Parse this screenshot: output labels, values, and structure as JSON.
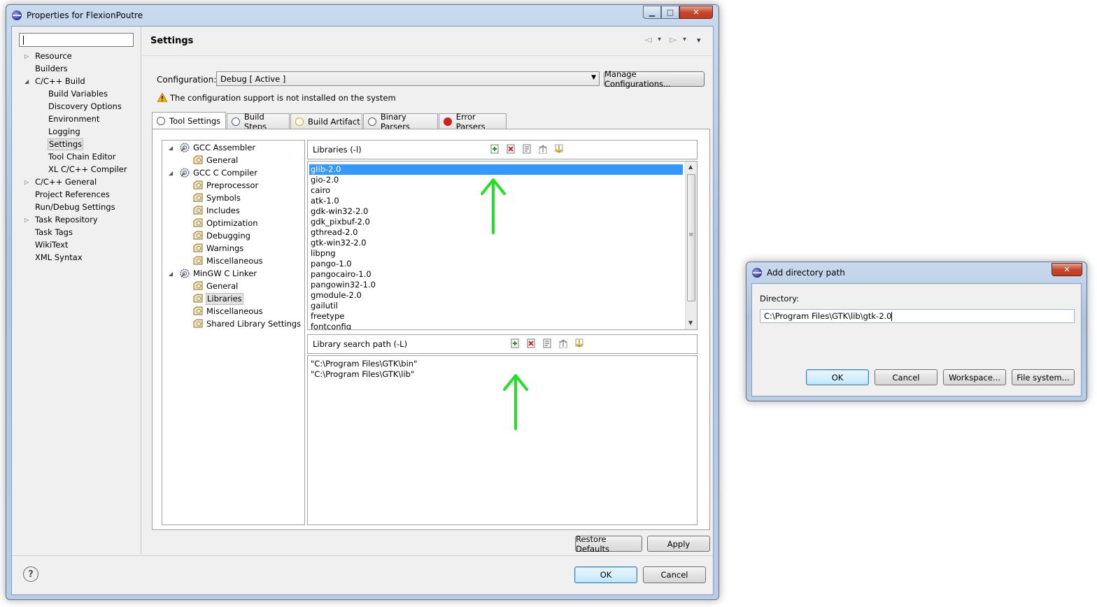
{
  "main_window": {
    "title": "Properties for FlexionPoutre",
    "minimize": "▁",
    "maximize": "□",
    "close": "✕"
  },
  "filter": {
    "value": "",
    "placeholder": ""
  },
  "nav_tree": [
    {
      "label": "Resource",
      "level": 0,
      "expander": "▷"
    },
    {
      "label": "Builders",
      "level": 0,
      "expander": ""
    },
    {
      "label": "C/C++ Build",
      "level": 0,
      "expander": "◢"
    },
    {
      "label": "Build Variables",
      "level": 1,
      "expander": ""
    },
    {
      "label": "Discovery Options",
      "level": 1,
      "expander": ""
    },
    {
      "label": "Environment",
      "level": 1,
      "expander": ""
    },
    {
      "label": "Logging",
      "level": 1,
      "expander": ""
    },
    {
      "label": "Settings",
      "level": 1,
      "expander": "",
      "selected": true
    },
    {
      "label": "Tool Chain Editor",
      "level": 1,
      "expander": ""
    },
    {
      "label": "XL C/C++ Compiler",
      "level": 1,
      "expander": ""
    },
    {
      "label": "C/C++ General",
      "level": 0,
      "expander": "▷"
    },
    {
      "label": "Project References",
      "level": 0,
      "expander": ""
    },
    {
      "label": "Run/Debug Settings",
      "level": 0,
      "expander": ""
    },
    {
      "label": "Task Repository",
      "level": 0,
      "expander": "▷"
    },
    {
      "label": "Task Tags",
      "level": 0,
      "expander": ""
    },
    {
      "label": "WikiText",
      "level": 0,
      "expander": ""
    },
    {
      "label": "XML Syntax",
      "level": 0,
      "expander": ""
    }
  ],
  "page": {
    "title": "Settings",
    "configuration_label": "Configuration:",
    "configuration_value": "Debug  [ Active ]",
    "manage_button": "Manage Configurations...",
    "warning_text": "The configuration support is not installed on the system",
    "tabs": [
      "Tool Settings",
      "Build Steps",
      "Build Artifact",
      "Binary Parsers",
      "Error Parsers"
    ],
    "restore_defaults": "Restore Defaults",
    "apply": "Apply"
  },
  "tool_tree": [
    {
      "label": "GCC Assembler",
      "level": 0,
      "expander": "◢"
    },
    {
      "label": "General",
      "level": 1
    },
    {
      "label": "GCC C Compiler",
      "level": 0,
      "expander": "◢"
    },
    {
      "label": "Preprocessor",
      "level": 1
    },
    {
      "label": "Symbols",
      "level": 1
    },
    {
      "label": "Includes",
      "level": 1
    },
    {
      "label": "Optimization",
      "level": 1
    },
    {
      "label": "Debugging",
      "level": 1
    },
    {
      "label": "Warnings",
      "level": 1
    },
    {
      "label": "Miscellaneous",
      "level": 1
    },
    {
      "label": "MinGW C Linker",
      "level": 0,
      "expander": "◢"
    },
    {
      "label": "General",
      "level": 1
    },
    {
      "label": "Libraries",
      "level": 1,
      "selected": true
    },
    {
      "label": "Miscellaneous",
      "level": 1
    },
    {
      "label": "Shared Library Settings",
      "level": 1
    }
  ],
  "libraries": {
    "label": "Libraries (-l)",
    "items": [
      "glib-2.0",
      "gio-2.0",
      "cairo",
      "atk-1.0",
      "gdk-win32-2.0",
      "gdk_pixbuf-2.0",
      "gthread-2.0",
      "gtk-win32-2.0",
      "libpng",
      "pango-1.0",
      "pangocairo-1.0",
      "pangowin32-1.0",
      "gmodule-2.0",
      "gailutil",
      "freetype",
      "fontconfig"
    ]
  },
  "library_paths": {
    "label": "Library search path (-L)",
    "items": [
      "\"C:\\Program Files\\GTK\\bin\"",
      "\"C:\\Program Files\\GTK\\lib\""
    ]
  },
  "footer": {
    "ok": "OK",
    "cancel": "Cancel",
    "help": "?"
  },
  "dialog": {
    "title": "Add directory path",
    "close": "✕",
    "directory_label": "Directory:",
    "directory_value": "C:\\Program Files\\GTK\\lib\\gtk-2.0",
    "ok": "OK",
    "cancel": "Cancel",
    "workspace": "Workspace...",
    "file_system": "File system..."
  },
  "colors": {
    "accent_arrow": "#22e022",
    "selection": "#3399ff",
    "warning": "#f0b400"
  },
  "icons": {
    "add": "add-icon",
    "delete": "delete-icon",
    "edit": "edit-icon",
    "move_up": "move-up-icon",
    "move_down": "move-down-icon",
    "nav_back": "◅",
    "nav_forward": "▻",
    "nav_menu": "▾"
  }
}
